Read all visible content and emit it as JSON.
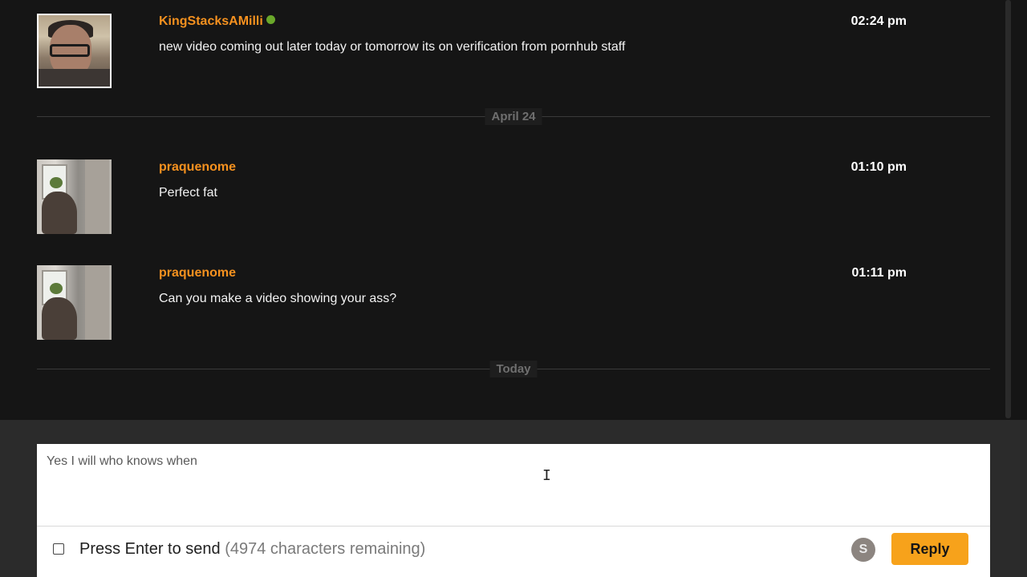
{
  "messages": [
    {
      "username": "KingStacksAMilli",
      "online": true,
      "text": "new video coming out later today or tomorrow its on verification from pornhub staff",
      "time": "02:24 pm"
    },
    {
      "username": "praquenome",
      "online": false,
      "text": "Perfect fat",
      "time": "01:10 pm"
    },
    {
      "username": "praquenome",
      "online": false,
      "text": "Can you make a video showing your ass?",
      "time": "01:11 pm"
    }
  ],
  "dividers": {
    "first": "April 24",
    "second": "Today"
  },
  "composer": {
    "reply_text": "Yes I will who knows when",
    "enter_to_send_label": "Press Enter to send",
    "enter_to_send_checked": false,
    "characters_remaining": "(4974 characters remaining)",
    "badge_letter": "S",
    "reply_button_label": "Reply"
  },
  "colors": {
    "background": "#151515",
    "username": "#f5911f",
    "online_indicator": "#6aa82a",
    "reply_button": "#f7a21b",
    "composer_bar": "#2b2b2b"
  }
}
